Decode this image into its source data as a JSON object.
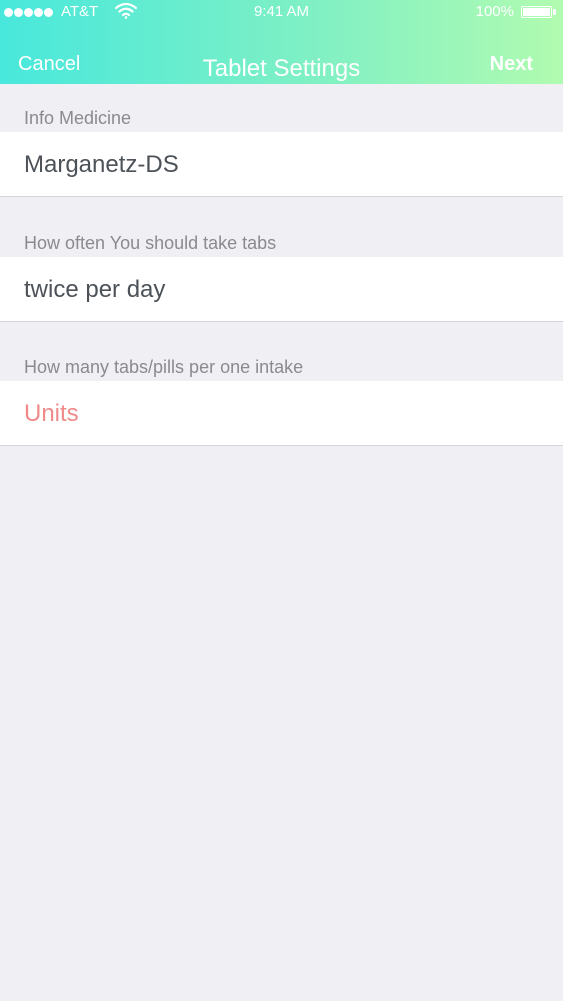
{
  "status_bar": {
    "carrier": "AT&T",
    "time": "9:41 AM",
    "battery_percent": "100%",
    "signal_bars": 5,
    "battery_level": 1.0
  },
  "nav": {
    "cancel_label": "Cancel",
    "title": "Tablet Settings",
    "next_label": "Next"
  },
  "form": {
    "medicine": {
      "label": "Info Medicine",
      "value": "Marganetz-DS"
    },
    "frequency": {
      "label": "How often You should take tabs",
      "value": "twice per day"
    },
    "dosage": {
      "label": "How many tabs/pills per one intake",
      "placeholder": "Units"
    }
  },
  "colors": {
    "header_gradient_start": "#48e8dc",
    "header_gradient_end": "#b1fbb0",
    "background": "#efeff4",
    "placeholder": "#f08a8a",
    "value_text": "#4c5258",
    "label_text": "#8a8a8f"
  }
}
